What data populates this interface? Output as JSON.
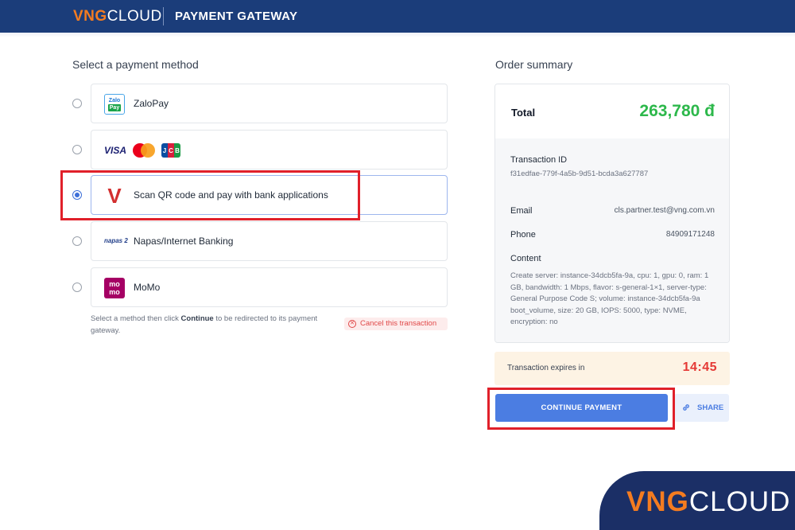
{
  "header": {
    "logo_brand": "VNG",
    "logo_suffix": "CLOUD",
    "title": "PAYMENT GATEWAY"
  },
  "methods_section": {
    "title": "Select a payment method",
    "methods": [
      {
        "label": "ZaloPay",
        "icon": "zalopay-logo-icon",
        "icon_text_1": "Zalo",
        "icon_text_2": "Pay",
        "selected": false
      },
      {
        "label": "",
        "icon": "card-brands-icon",
        "brands": [
          "VISA",
          "J",
          "C",
          "B"
        ],
        "selected": false
      },
      {
        "label": "Scan QR code and pay with bank applications",
        "icon": "vietqr-logo-icon",
        "icon_text": "V",
        "selected": true
      },
      {
        "label": "Napas/Internet Banking",
        "icon": "napas-logo-icon",
        "icon_text": "napas 2",
        "selected": false
      },
      {
        "label": "MoMo",
        "icon": "momo-logo-icon",
        "icon_text_1": "mo",
        "icon_text_2": "mo",
        "selected": false
      }
    ],
    "hint_prefix": "Select a method then click ",
    "hint_bold": "Continue",
    "hint_suffix": " to be redirected to its payment gateway.",
    "cancel_label": "Cancel this transaction"
  },
  "order_summary": {
    "title": "Order summary",
    "total_label": "Total",
    "total_value": "263,780 đ",
    "transaction_id_label": "Transaction ID",
    "transaction_id": "f31edfae-779f-4a5b-9d51-bcda3a627787",
    "email_label": "Email",
    "email": "cls.partner.test@vng.com.vn",
    "phone_label": "Phone",
    "phone": "84909171248",
    "content_label": "Content",
    "content": "Create server: instance-34dcb5fa-9a, cpu: 1, gpu: 0, ram: 1 GB, bandwidth: 1 Mbps, flavor: s-general-1×1, server-type: General Purpose Code S; volume: instance-34dcb5fa-9a boot_volume, size: 20 GB, IOPS: 5000, type: NVME, encryption: no"
  },
  "expires": {
    "label": "Transaction expires in",
    "countdown": "14:45"
  },
  "actions": {
    "continue_label": "CONTINUE PAYMENT",
    "share_label": "SHARE"
  },
  "watermark": {
    "brand": "VNG",
    "suffix": "CLOUD"
  },
  "colors": {
    "header_bg": "#1b3d7a",
    "brand_orange": "#f47c20",
    "primary_blue": "#4b7de2",
    "total_green": "#2db84b",
    "countdown_red": "#e53935",
    "annotation_red": "#e0202a"
  }
}
